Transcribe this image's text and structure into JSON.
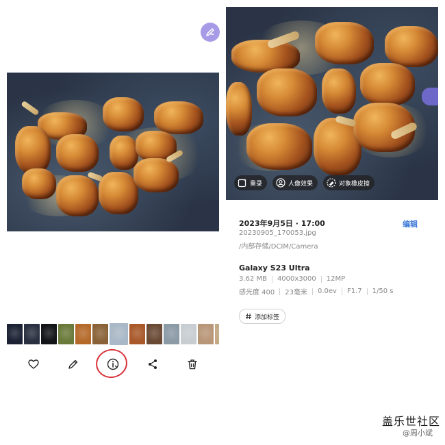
{
  "left_panel": {
    "toolbar": {
      "favorite_icon": "heart-icon",
      "edit_icon": "pencil-icon",
      "details_icon": "info-icon",
      "share_icon": "share-icon",
      "delete_icon": "trash-icon"
    },
    "filmstrip": {
      "selected_index": 6,
      "thumbnails": [
        {
          "name": "night-sky",
          "color": "#1b2233"
        },
        {
          "name": "night-sky-2",
          "color": "#2a3040"
        },
        {
          "name": "dark-scene",
          "color": "#121418"
        },
        {
          "name": "green-dish",
          "color": "#6a7a3a"
        },
        {
          "name": "orange-dish",
          "color": "#b56a2a"
        },
        {
          "name": "brown-dish",
          "color": "#8a6238"
        },
        {
          "name": "outdoor",
          "color": "#a9b8c6"
        },
        {
          "name": "fried-ribs",
          "color": "#a9582a"
        },
        {
          "name": "plated-food",
          "color": "#6a4a35"
        },
        {
          "name": "street",
          "color": "#8a9aa6"
        },
        {
          "name": "bright-street",
          "color": "#c7cdd1"
        },
        {
          "name": "bowl",
          "color": "#b89678"
        },
        {
          "name": "soup",
          "color": "#c4a985"
        },
        {
          "name": "pale-dish",
          "color": "#d9d2c4"
        }
      ]
    }
  },
  "right_panel": {
    "chips": [
      {
        "icon": "remaster-icon",
        "label": "重录"
      },
      {
        "icon": "portrait-icon",
        "label": "人像效果"
      },
      {
        "icon": "eraser-icon",
        "label": "对象橡皮擦"
      }
    ],
    "info": {
      "datetime": "2023年9月5日 · 17:00",
      "edit_label": "编辑",
      "filename": "20230905_170053.jpg",
      "path": "/内部存储/DCIM/Camera",
      "model": "Galaxy S23 Ultra",
      "specs_row1": [
        "3.62 MB",
        "4000x3000",
        "12MP"
      ],
      "specs_row2": [
        "感光度 400",
        "23毫米",
        "0.0ev",
        "F1.7",
        "1/50 s"
      ],
      "add_tag_label": "添加标签"
    }
  },
  "watermark": {
    "brand": "盖乐世社区",
    "user": "@周小斌"
  },
  "colors": {
    "accent_blue": "#3e7ad8",
    "annotation_red": "#d9333a",
    "edit_fab": "#a79be8"
  }
}
